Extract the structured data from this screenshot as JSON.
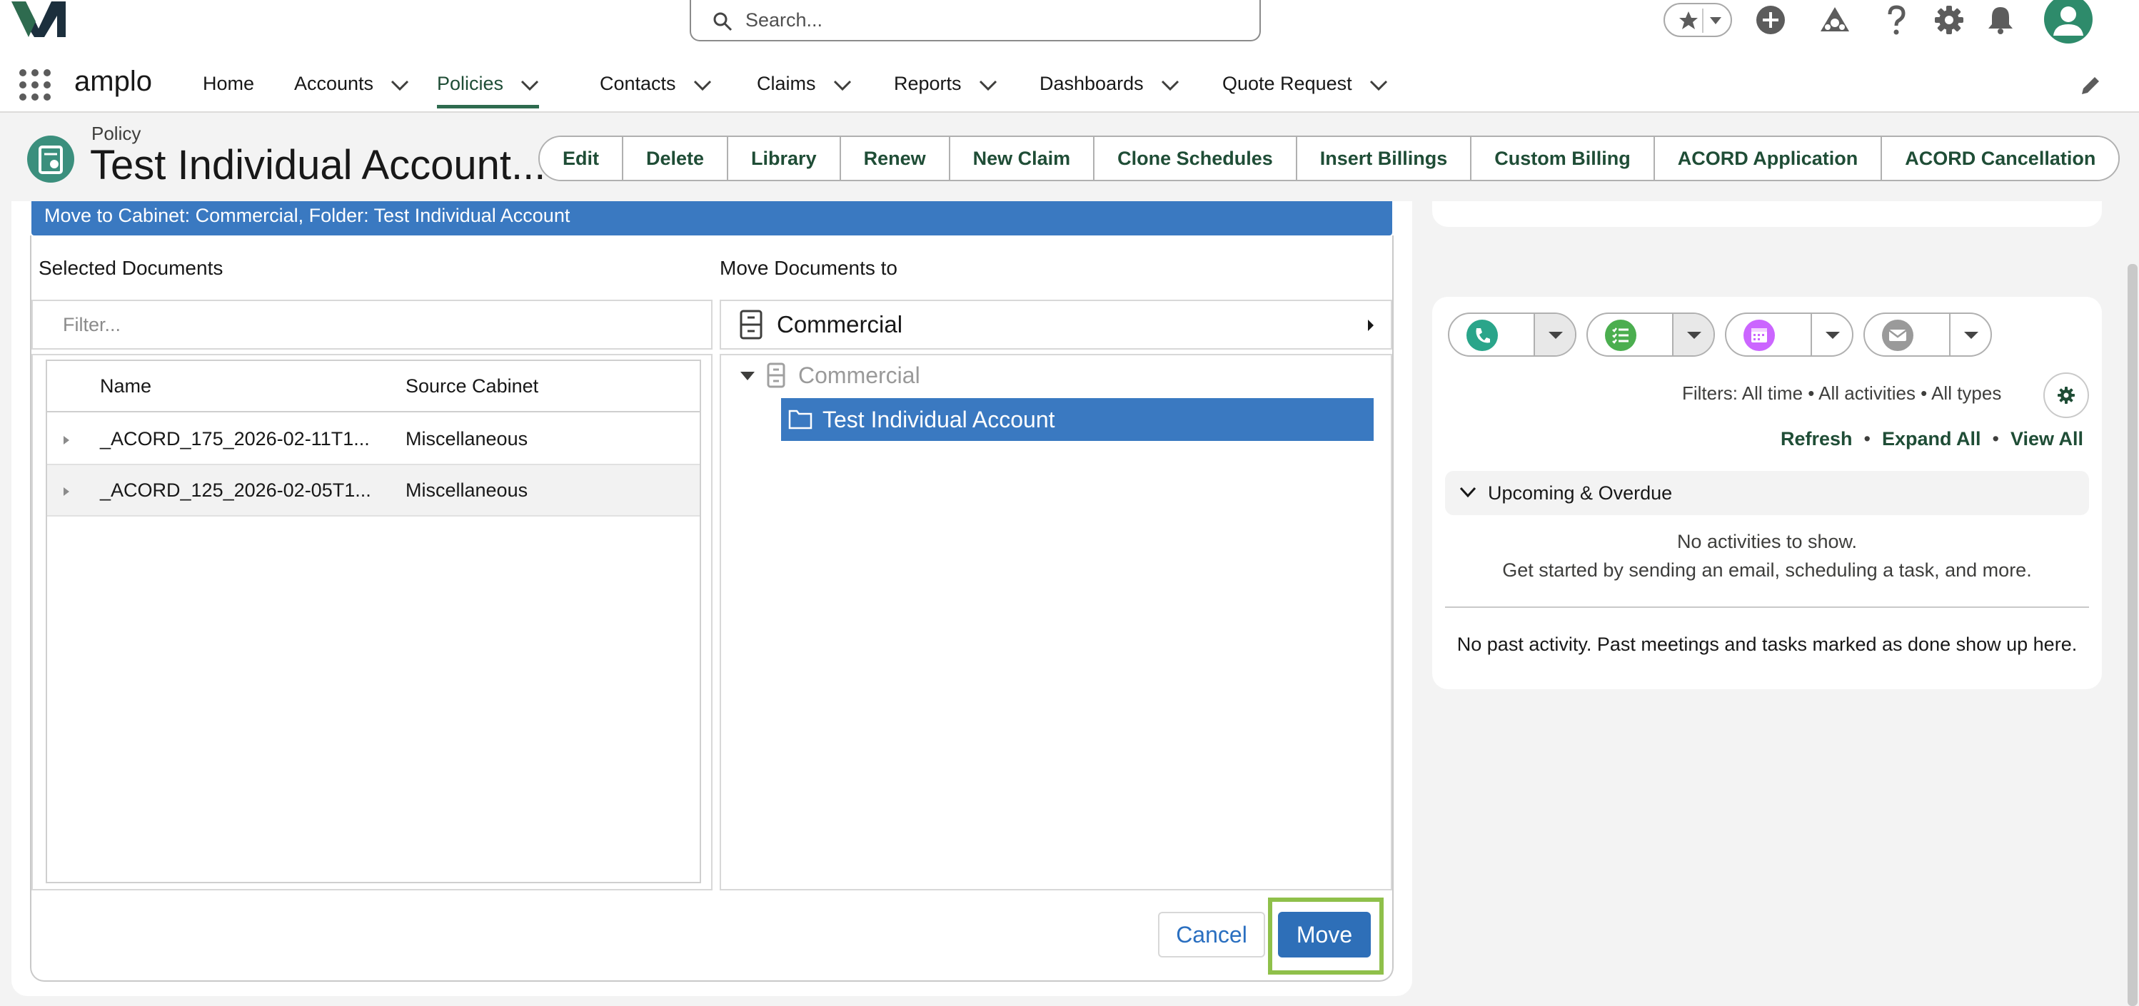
{
  "app": {
    "name": "amplo"
  },
  "search": {
    "placeholder": "Search..."
  },
  "nav": {
    "items": [
      {
        "label": "Home"
      },
      {
        "label": "Accounts"
      },
      {
        "label": "Policies"
      },
      {
        "label": "Contacts"
      },
      {
        "label": "Claims"
      },
      {
        "label": "Reports"
      },
      {
        "label": "Dashboards"
      },
      {
        "label": "Quote Request"
      }
    ],
    "active": "Policies"
  },
  "record": {
    "type": "Policy",
    "title": "Test Individual Account...",
    "actions": [
      "Edit",
      "Delete",
      "Library",
      "Renew",
      "New Claim",
      "Clone Schedules",
      "Insert Billings",
      "Custom Billing",
      "ACORD Application",
      "ACORD Cancellation"
    ]
  },
  "move_dialog": {
    "banner": "Move to Cabinet: Commercial, Folder: Test Individual Account",
    "selected_label": "Selected Documents",
    "filter_placeholder": "Filter...",
    "columns": [
      "Name",
      "Source Cabinet"
    ],
    "rows": [
      {
        "name": "_ACORD_175_2026-02-11T1...",
        "source": "Miscellaneous"
      },
      {
        "name": "_ACORD_125_2026-02-05T1...",
        "source": "Miscellaneous"
      }
    ],
    "dest_label": "Move Documents to",
    "dest_cabinet": "Commercial",
    "tree_root": "Commercial",
    "tree_selected": "Test Individual Account",
    "cancel_label": "Cancel",
    "move_label": "Move"
  },
  "activity": {
    "filters": "Filters: All time • All activities • All types",
    "links": [
      "Refresh",
      "Expand All",
      "View All"
    ],
    "section": "Upcoming & Overdue",
    "empty_line1": "No activities to show.",
    "empty_line2": "Get started by sending an email, scheduling a task, and more.",
    "past": "No past activity. Past meetings and tasks marked as done show up here."
  },
  "colors": {
    "brand_green": "#1f4d36",
    "selection_blue": "#3a79c1",
    "move_button": "#2e6fb8",
    "highlight": "#8fc04a"
  }
}
